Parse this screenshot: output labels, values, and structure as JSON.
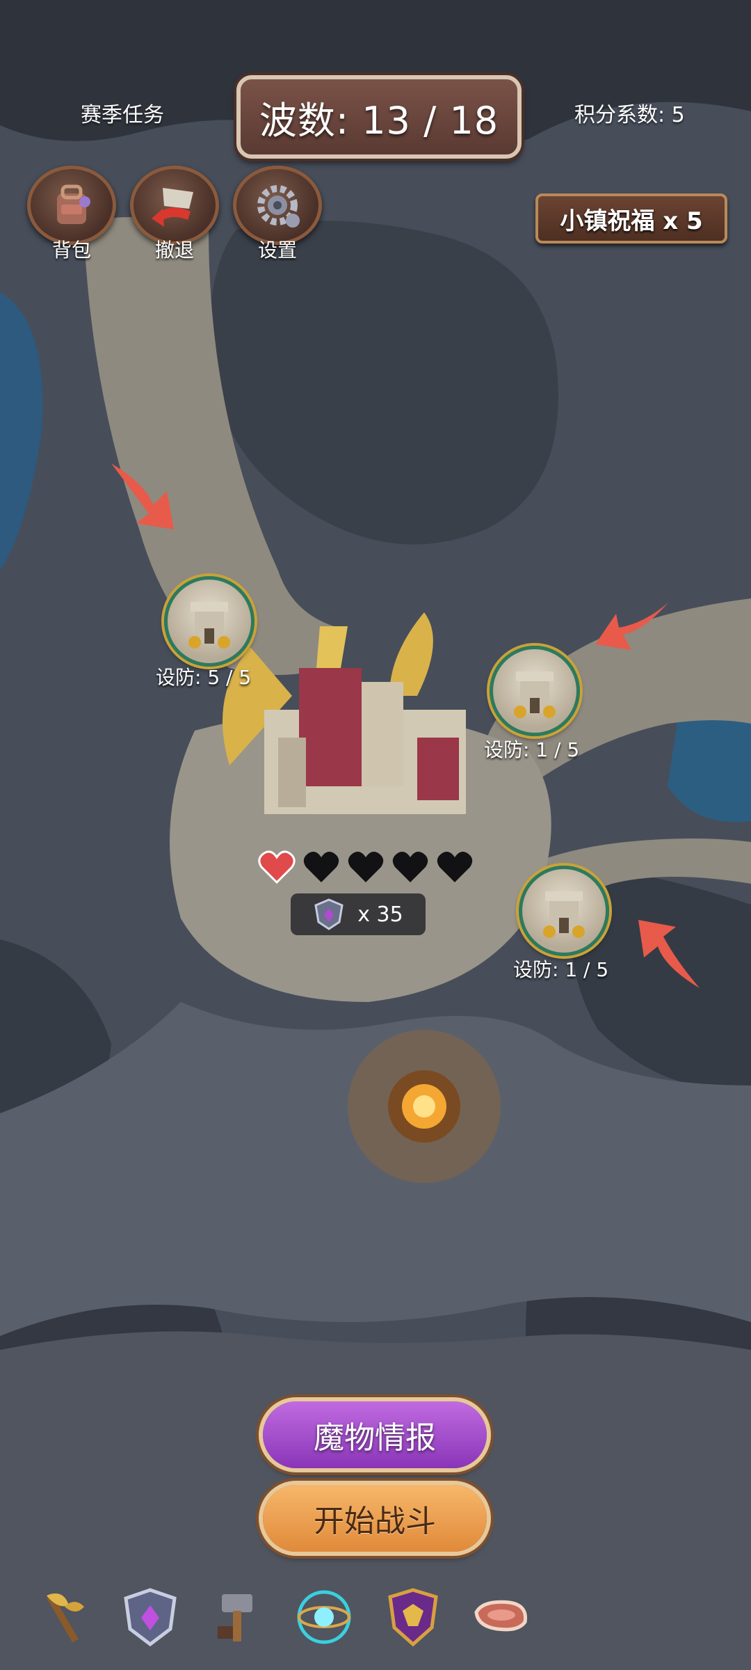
{
  "hud": {
    "season_tasks": "赛季任务",
    "wave": "波数: 13 / 18",
    "score_multiplier": "积分系数: 5",
    "town_blessing": "小镇祝福 x 5"
  },
  "top_buttons": [
    {
      "label": "背包",
      "icon": "backpack-icon"
    },
    {
      "label": "撤退",
      "icon": "retreat-flag-icon"
    },
    {
      "label": "设置",
      "icon": "gear-icon"
    }
  ],
  "towers": [
    {
      "label": "设防: 5 / 5"
    },
    {
      "label": "设防: 1 / 5"
    },
    {
      "label": "设防: 1 / 5"
    }
  ],
  "base": {
    "hearts_filled": 1,
    "hearts_total": 5,
    "rank_count": "x 35"
  },
  "buttons": {
    "monster_intel": "魔物情报",
    "start_battle": "开始战斗"
  },
  "bottom_bar": [
    "axe-weapon-icon",
    "rank-shield-icon",
    "hammer-icon",
    "magic-orb-icon",
    "emblem-shield-icon",
    "meat-icon"
  ],
  "colors": {
    "intel_button": "#a74fd0",
    "start_button": "#f0a456",
    "arrow": "#e85a4a",
    "heart": "#e04a4a"
  }
}
